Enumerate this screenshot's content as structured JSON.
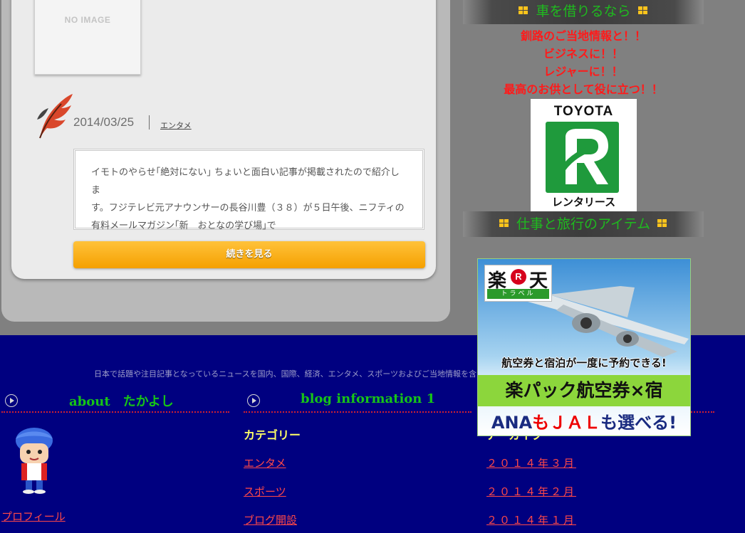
{
  "post": {
    "noimage_label": "NO IMAGE",
    "date": "2014/03/25",
    "category": "エンタメ",
    "excerpt_lines": [
      "イモトのやらせ｢絶対にない｣ ちょいと面白い記事が掲載されたので紹介しま",
      "す。フジテレビ元アナウンサーの長谷川豊（３８）が５日午後、ニフティの",
      "有料メールマガジン｢新　おとなの学び場｣で"
    ],
    "read_more": "続きを見る"
  },
  "sidebar": {
    "car_heading": "車を借りるなら",
    "promo_lines": [
      "釧路のご当地情報と！！",
      "ビジネスに！！",
      "レジャーに！！",
      "最高のお供として役に立つ！！"
    ],
    "toyota_brand": "TOYOTA",
    "toyota_sub": "レンタリース",
    "items_heading": "仕事と旅行のアイテム",
    "rakuten": {
      "logo_kanji_1": "楽",
      "logo_r": "R",
      "logo_kanji_2": "天",
      "logo_sub": "トラベル",
      "line1": "航空券と宿泊が一度に予約できる!",
      "line2": "楽パック航空券×宿",
      "line3_a": "ANA",
      "line3_b": "も",
      "line3_c": "ＪＡＬ",
      "line3_d": "も選べる!"
    }
  },
  "footer": {
    "tagline": "日本で話題や注目記事となっているニュースを国内、国際、経済、エンタメ、スポーツおよびご当地情報を含",
    "about_title": "about　たかよし",
    "profile_link": "プロフィール",
    "blog_title": "blog information 1",
    "categories_heading": "カテゴリー",
    "categories": [
      "エンタメ",
      "スポーツ",
      "ブログ開設"
    ],
    "archives_heading": "アーカイブ",
    "archives": [
      "２０１４年３月",
      "２０１４年２月",
      "２０１４年１月"
    ]
  },
  "colors": {
    "footer_bg": "#000080",
    "green_heading": "#1fba1f",
    "promo_red": "#ff1a1a",
    "link_red": "#ff4848",
    "button_orange": "#f5a000",
    "category_yellow": "#ffff66"
  }
}
